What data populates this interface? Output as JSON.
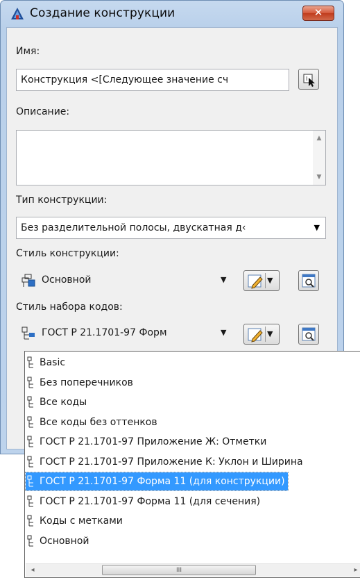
{
  "window": {
    "title": "Создание конструкции",
    "close_label": "✕"
  },
  "form": {
    "name_label": "Имя:",
    "name_value": "Конструкция <[Следующее значение сч",
    "description_label": "Описание:",
    "description_value": "",
    "type_label": "Тип конструкции:",
    "type_value": "Без разделительной полосы, двускатная д‹",
    "style_label": "Стиль конструкции:",
    "style_value": "Основной",
    "codeset_label": "Стиль набора кодов:",
    "codeset_value": "ГОСТ Р 21.1701-97 Форм"
  },
  "dropdown": {
    "items": [
      "Basic",
      "Без поперечников",
      "Все коды",
      "Все коды без оттенков",
      "ГОСТ Р 21.1701-97 Приложение Ж: Отметки",
      "ГОСТ Р 21.1701-97 Приложение К: Уклон и Ширина",
      "ГОСТ Р 21.1701-97 Форма 11 (для конструкции)",
      "ГОСТ Р 21.1701-97 Форма 11 (для сечения)",
      "Коды с метками",
      "Основной"
    ],
    "selected_index": 6,
    "scroll_grip": "III"
  },
  "colors": {
    "title_bar": "#bdd3ec",
    "selection": "#3399ff",
    "close_button": "#c8472a"
  }
}
